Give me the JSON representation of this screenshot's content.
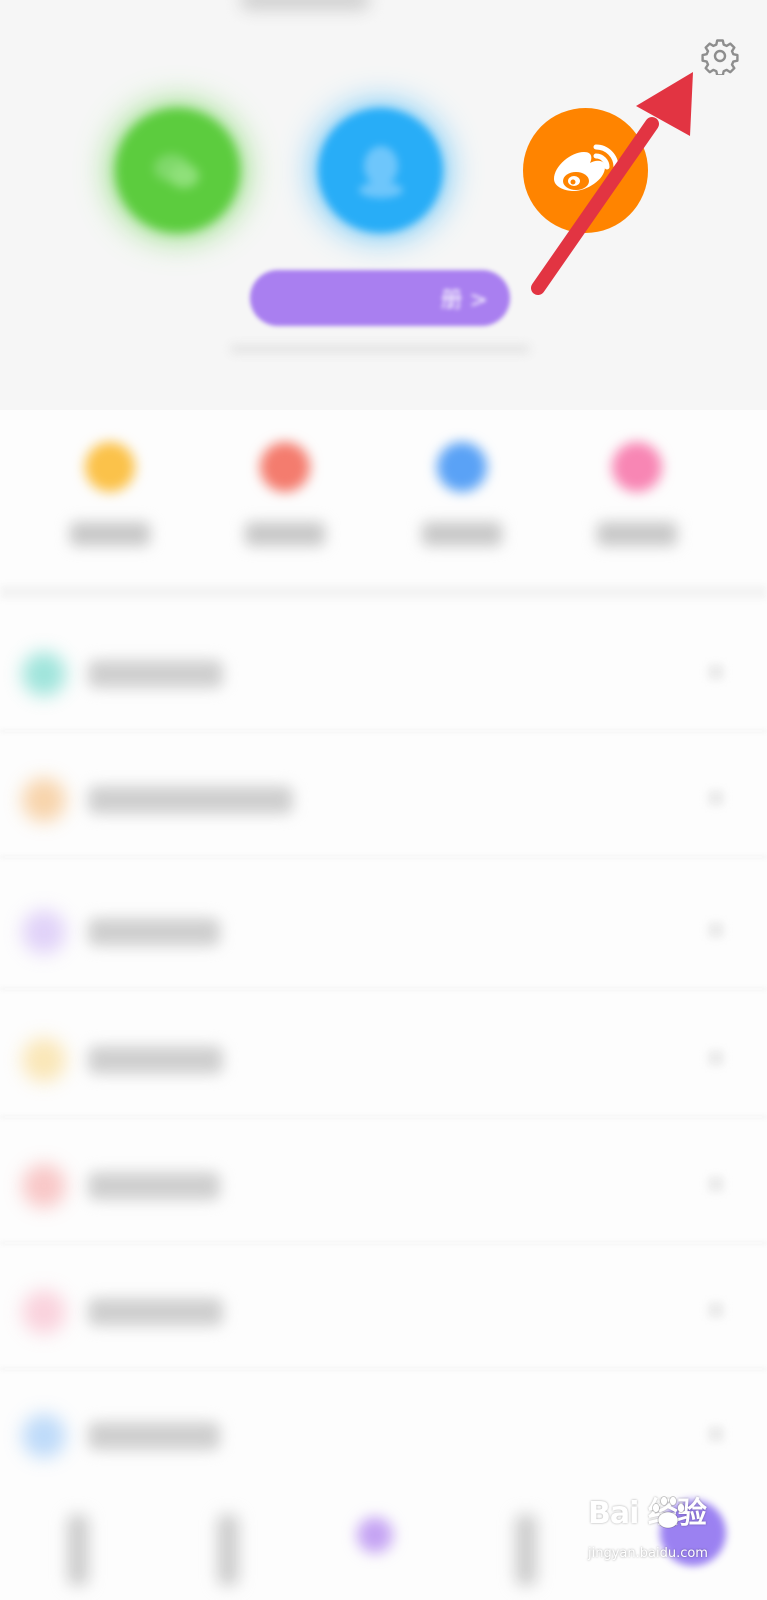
{
  "top": {
    "settings_icon": "gear-icon",
    "social_icons": [
      "wechat-icon",
      "qq-icon",
      "weibo-icon"
    ],
    "login_suffix": "册 >"
  },
  "quick_actions": {
    "icon_colors": [
      "#fbc24a",
      "#f47c6e",
      "#5aa2f6",
      "#f886b4"
    ]
  },
  "list": {
    "icon_colors": [
      "#7fdcd0",
      "#f6c690",
      "#d7c4f7",
      "#f9dfa0",
      "#f7b5b5",
      "#f9c4d2",
      "#a9cff8"
    ]
  },
  "annotation": {
    "arrow_color": "#e23442"
  },
  "watermark": {
    "logo_text": "Bai  经验",
    "url": "jingyan.baidu.com"
  }
}
